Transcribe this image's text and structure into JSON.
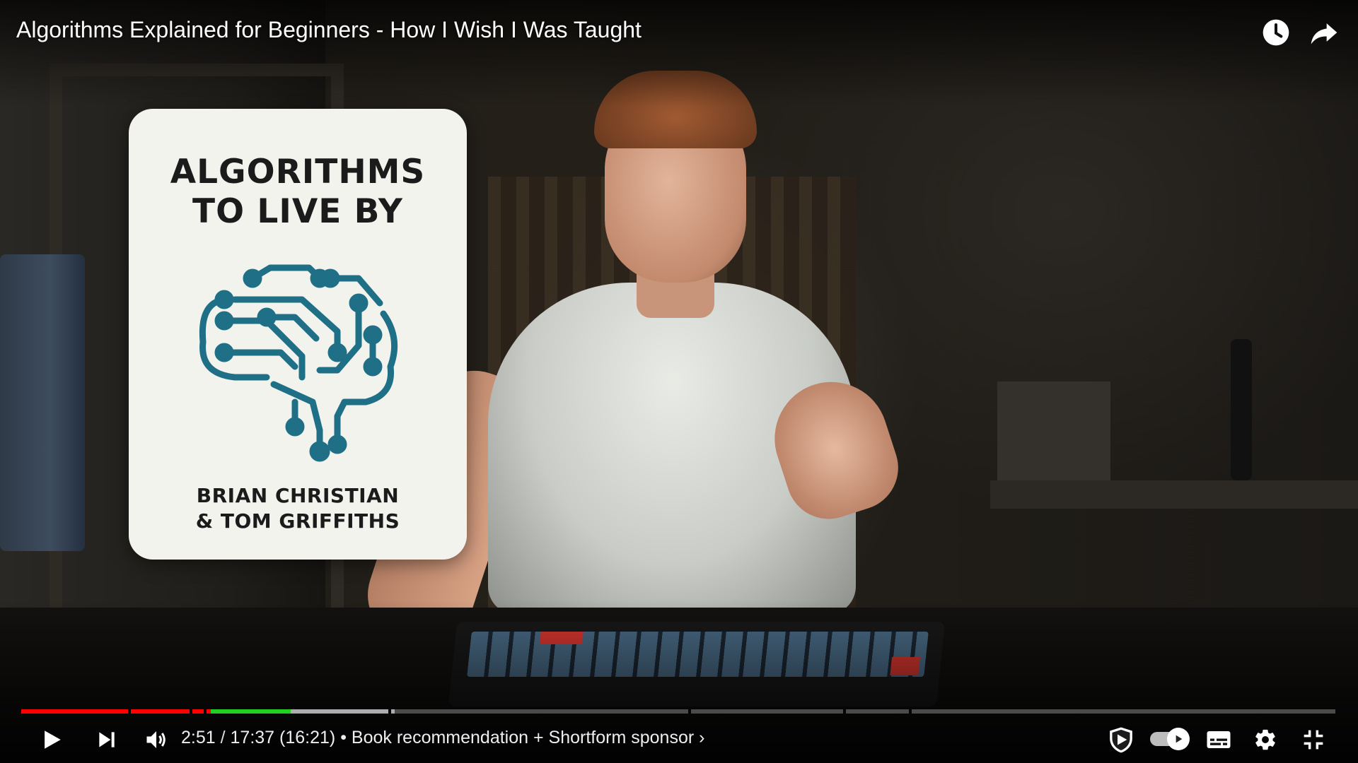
{
  "video": {
    "title": "Algorithms Explained for Beginners - How I Wish I Was Taught"
  },
  "book_overlay": {
    "title_line1": "ALGORITHMS",
    "title_line2": "TO LIVE BY",
    "authors_line1": "BRIAN CHRISTIAN",
    "authors_line2": "& TOM GRIFFITHS"
  },
  "player": {
    "current_time": "2:51",
    "time_separator": " / ",
    "duration": "17:37",
    "adjusted_duration": " (16:21)",
    "bullet": " • ",
    "chapter": "Book recommendation + Shortform sponsor",
    "chapter_chevron": "›",
    "progress_fraction": 0.162,
    "buffered_fraction": 0.283
  },
  "icons": {
    "watch_later": "clock-icon",
    "share": "share-icon",
    "play": "play-icon",
    "next": "next-icon",
    "volume": "volume-icon",
    "sponsorblock": "sponsorblock-shield-icon",
    "autoplay": "autoplay-toggle-icon",
    "captions": "subtitles-icon",
    "settings": "gear-icon",
    "exit_fullscreen": "exit-fullscreen-icon"
  },
  "colors": {
    "progress_played": "#ff0000",
    "sponsor_segment": "#20d020",
    "book_logo": "#1f6f86"
  }
}
